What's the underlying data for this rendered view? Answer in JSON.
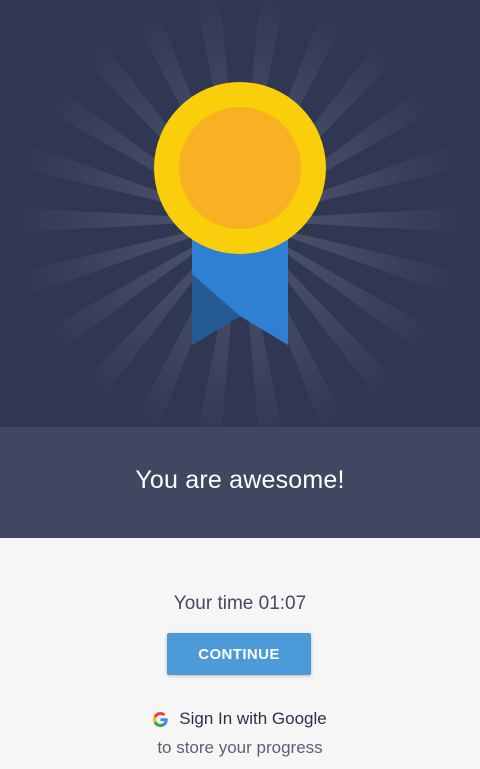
{
  "award": {
    "medal_outer_color": "#f9cf0b",
    "medal_inner_color": "#f8b122",
    "ribbon_color": "#2f80d3",
    "ribbon_shade_color": "#255b95",
    "icon": "medal-icon"
  },
  "banner": {
    "title": "You are awesome!"
  },
  "result": {
    "time_text": "Your time 01:07"
  },
  "actions": {
    "continue_label": "CONTINUE",
    "signin_label": "Sign In with Google",
    "signin_icon": "google-icon",
    "signin_subtitle": "to store your progress"
  }
}
